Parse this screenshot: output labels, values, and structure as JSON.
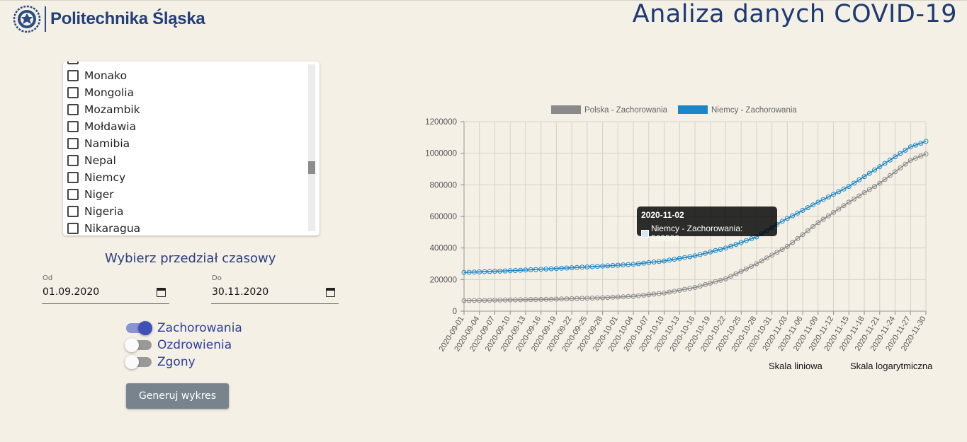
{
  "header": {
    "logo_text": "Politechnika Śląska",
    "title": "Analiza danych COVID-19"
  },
  "countries": {
    "items": [
      {
        "label": "Monako",
        "checked": false
      },
      {
        "label": "Mongolia",
        "checked": false
      },
      {
        "label": "Mozambik",
        "checked": false
      },
      {
        "label": "Mołdawia",
        "checked": false
      },
      {
        "label": "Namibia",
        "checked": false
      },
      {
        "label": "Nepal",
        "checked": false
      },
      {
        "label": "Niemcy",
        "checked": false
      },
      {
        "label": "Niger",
        "checked": false
      },
      {
        "label": "Nigeria",
        "checked": false
      },
      {
        "label": "Nikaragua",
        "checked": false
      }
    ]
  },
  "range": {
    "title": "Wybierz przedział czasowy",
    "from_label": "Od",
    "from_value": "01.09.2020",
    "to_label": "Do",
    "to_value": "30.11.2020"
  },
  "toggles": [
    {
      "label": "Zachorowania",
      "on": true
    },
    {
      "label": "Ozdrowienia",
      "on": false
    },
    {
      "label": "Zgony",
      "on": false
    }
  ],
  "generate_label": "Generuj wykres",
  "scale_linear_label": "Skala liniowa",
  "scale_log_label": "Skala logarytmiczna",
  "colors": {
    "polska": "#8a8a8a",
    "niemcy": "#1a86c8",
    "accent": "#3f51b5"
  },
  "chart_data": {
    "type": "line",
    "x_start": "2020-09-01",
    "x_end": "2020-11-30",
    "x_tick_labels": [
      "2020-09-01",
      "2020-09-04",
      "2020-09-07",
      "2020-09-10",
      "2020-09-13",
      "2020-09-16",
      "2020-09-19",
      "2020-09-22",
      "2020-09-25",
      "2020-09-28",
      "2020-10-01",
      "2020-10-04",
      "2020-10-07",
      "2020-10-10",
      "2020-10-13",
      "2020-10-16",
      "2020-10-19",
      "2020-10-22",
      "2020-10-25",
      "2020-10-28",
      "2020-10-31",
      "2020-11-03",
      "2020-11-06",
      "2020-11-09",
      "2020-11-12",
      "2020-11-15",
      "2020-11-18",
      "2020-11-21",
      "2020-11-24",
      "2020-11-27",
      "2020-11-30"
    ],
    "y_ticks": [
      0,
      200000,
      400000,
      600000,
      800000,
      1000000,
      1200000
    ],
    "ylim": [
      0,
      1200000
    ],
    "grid": true,
    "legend_position": "top",
    "series": [
      {
        "name": "Polska - Zachorowania",
        "color": "#8a8a8a",
        "anchors": [
          [
            "2020-09-01",
            67000
          ],
          [
            "2020-09-10",
            71000
          ],
          [
            "2020-09-19",
            76000
          ],
          [
            "2020-09-28",
            85000
          ],
          [
            "2020-10-04",
            94000
          ],
          [
            "2020-10-10",
            115000
          ],
          [
            "2020-10-16",
            150000
          ],
          [
            "2020-10-22",
            205000
          ],
          [
            "2020-10-28",
            300000
          ],
          [
            "2020-11-03",
            410000
          ],
          [
            "2020-11-09",
            560000
          ],
          [
            "2020-11-15",
            690000
          ],
          [
            "2020-11-21",
            810000
          ],
          [
            "2020-11-27",
            955000
          ],
          [
            "2020-11-30",
            995000
          ]
        ]
      },
      {
        "name": "Niemcy - Zachorowania",
        "color": "#1a86c8",
        "anchors": [
          [
            "2020-09-01",
            245000
          ],
          [
            "2020-09-10",
            256000
          ],
          [
            "2020-09-19",
            270000
          ],
          [
            "2020-09-28",
            285000
          ],
          [
            "2020-10-04",
            297000
          ],
          [
            "2020-10-10",
            318000
          ],
          [
            "2020-10-16",
            350000
          ],
          [
            "2020-10-22",
            400000
          ],
          [
            "2020-10-28",
            470000
          ],
          [
            "2020-11-02",
            569598
          ],
          [
            "2020-11-09",
            690000
          ],
          [
            "2020-11-15",
            790000
          ],
          [
            "2020-11-21",
            915000
          ],
          [
            "2020-11-27",
            1040000
          ],
          [
            "2020-11-30",
            1075000
          ]
        ]
      }
    ],
    "tooltip": {
      "date": "2020-11-02",
      "text": "Niemcy - Zachorowania: 569598"
    }
  }
}
